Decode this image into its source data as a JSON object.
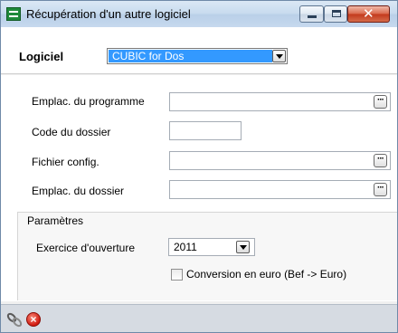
{
  "window": {
    "title": "Récupération d'un autre logiciel",
    "controls": {
      "minimize": "minimize",
      "maximize": "maximize",
      "close": "✕"
    }
  },
  "header": {
    "logiciel_label": "Logiciel",
    "logiciel_value": "CUBIC for Dos"
  },
  "fields": {
    "emplac_programme": {
      "label": "Emplac. du programme",
      "value": ""
    },
    "code_dossier": {
      "label": "Code du dossier",
      "value": ""
    },
    "fichier_config": {
      "label": "Fichier config.",
      "value": ""
    },
    "emplac_dossier": {
      "label": "Emplac. du dossier",
      "value": ""
    },
    "browse_label": "···"
  },
  "parametres": {
    "title": "Paramètres",
    "exercice_label": "Exercice d'ouverture",
    "exercice_value": "2011",
    "conversion_label": "Conversion en euro (Bef -> Euro)",
    "conversion_checked": false
  },
  "toolbar": {
    "icons": [
      "link-icon",
      "cancel-icon"
    ],
    "cancel_glyph": "×"
  },
  "colors": {
    "selection": "#3399ff",
    "close_button": "#c2391c",
    "app_icon": "#1f8a3a"
  }
}
